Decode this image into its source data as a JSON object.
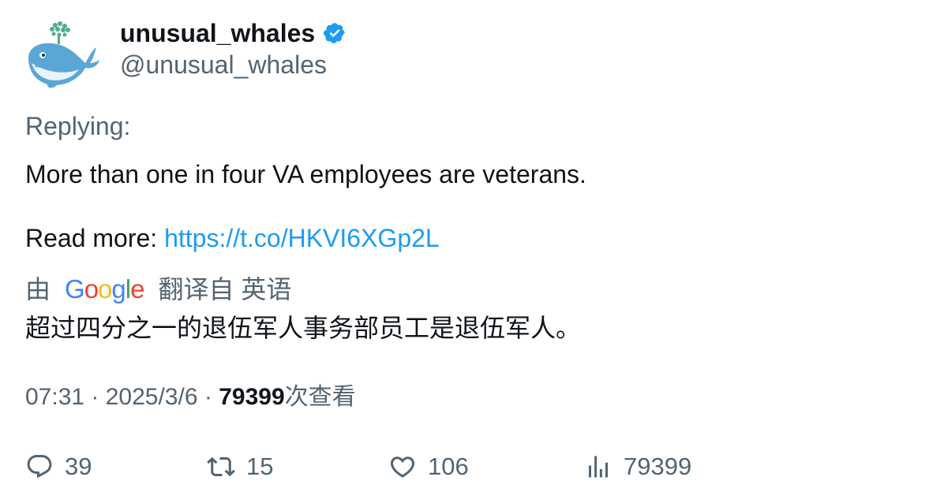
{
  "author": {
    "display_name": "unusual_whales",
    "handle": "@unusual_whales",
    "verified": true,
    "verified_badge_color": "#1d9bf0",
    "avatar_icon": "whale-logo-icon"
  },
  "tweet": {
    "replying_label": "Replying:",
    "line1": "More than one in four VA employees are veterans.",
    "read_more_label": "Read more: ",
    "link": "https://t.co/HKVI6XGp2L",
    "link_color": "#1d9bf0"
  },
  "translation": {
    "prefix": "由",
    "provider_logo": "Google",
    "suffix": "翻译自 英语",
    "text": "超过四分之一的退伍军人事务部员工是退伍军人。"
  },
  "meta": {
    "time": "07:31",
    "separator": " · ",
    "date": "2025/3/6",
    "views_count": "79399",
    "views_label": "次查看"
  },
  "actions": {
    "replies": "39",
    "retweets": "15",
    "likes": "106",
    "views": "79399"
  }
}
